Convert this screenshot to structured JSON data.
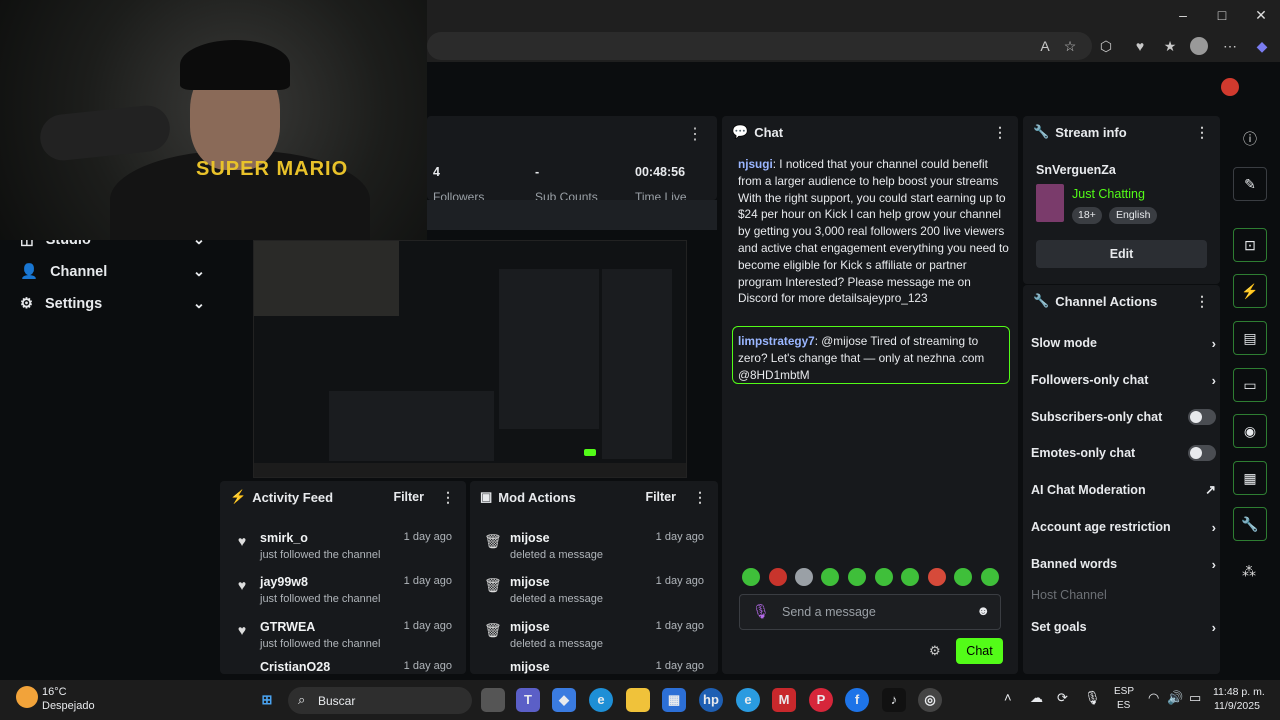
{
  "weather": {
    "temp": "16°C",
    "condition": "Despejado"
  },
  "taskbar": {
    "search_label": "Buscar",
    "lang_top": "ESP",
    "lang_bottom": "ES",
    "time": "11:48 p. m.",
    "date": "11/9/2025"
  },
  "nav": {
    "studio": "Studio",
    "channel": "Channel",
    "settings": "Settings"
  },
  "stats": {
    "followers_value": "4",
    "followers_label": "Followers",
    "subs_value": "-",
    "subs_label": "Sub Counts",
    "time_value": "00:48:56",
    "time_label": "Time Live"
  },
  "webcam": {
    "logo_text": "SUPER MARIO"
  },
  "activity_feed": {
    "title": "Activity Feed",
    "filter": "Filter",
    "items": [
      {
        "name": "smirk_o",
        "desc": "just followed the channel",
        "time": "1 day ago"
      },
      {
        "name": "jay99w8",
        "desc": "just followed the channel",
        "time": "1 day ago"
      },
      {
        "name": "GTRWEA",
        "desc": "just followed the channel",
        "time": "1 day ago"
      },
      {
        "name": "CristianO28",
        "desc": "",
        "time": "1 day ago"
      }
    ]
  },
  "mod_actions": {
    "title": "Mod Actions",
    "filter": "Filter",
    "items": [
      {
        "name": "mijose",
        "desc": "deleted a message",
        "time": "1 day ago"
      },
      {
        "name": "mijose",
        "desc": "deleted a message",
        "time": "1 day ago"
      },
      {
        "name": "mijose",
        "desc": "deleted a message",
        "time": "1 day ago"
      },
      {
        "name": "mijose",
        "desc": "",
        "time": "1 day ago"
      }
    ]
  },
  "chat": {
    "title": "Chat",
    "messages": [
      {
        "user": "njsugi",
        "text": "I noticed that your channel could benefit from a larger audience to help boost your streams With the right support, you could start earning up to $24 per hour on Kick I can help grow your channel by getting you 3,000 real followers 200 live viewers and active chat engagement everything you need to become eligible for Kick s affiliate or partner program Interested? Please message me on Discord for more detailsajeypro_123"
      },
      {
        "user": "limpstrategy7",
        "text": "@mijose Tired of streaming to zero? Let's change that — only at nezhna .com @8HD1mbtM"
      }
    ],
    "input_placeholder": "Send a message",
    "send_label": "Chat"
  },
  "stream_info": {
    "title": "Stream info",
    "channel_name": "SnVerguenZa",
    "category": "Just Chatting",
    "tags": [
      "18+",
      "English"
    ],
    "edit_label": "Edit"
  },
  "channel_actions": {
    "title": "Channel Actions",
    "slow_mode": "Slow mode",
    "followers_only": "Followers-only chat",
    "subscribers_only": "Subscribers-only chat",
    "emotes_only": "Emotes-only chat",
    "ai_moderation": "AI Chat Moderation",
    "account_age": "Account age restriction",
    "banned_words": "Banned words",
    "host_channel": "Host Channel",
    "set_goals": "Set goals"
  },
  "colors": {
    "accent": "#53fc18",
    "panel": "#17191c",
    "background": "#0b0d0f",
    "username": "#9ab6ff"
  }
}
